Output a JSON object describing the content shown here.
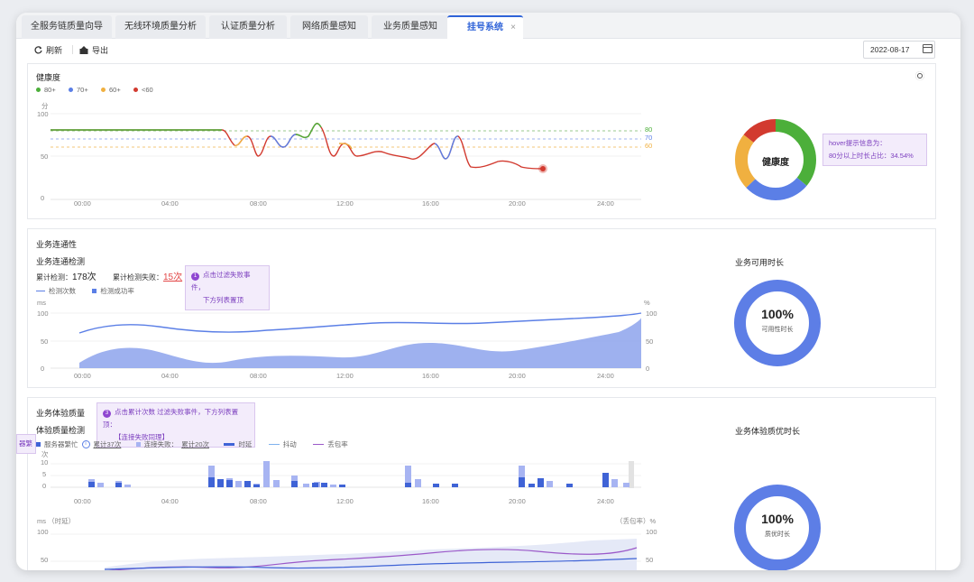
{
  "tabs": [
    {
      "label": "全服务链质量向导"
    },
    {
      "label": "无线环境质量分析"
    },
    {
      "label": "认证质量分析"
    },
    {
      "label": "网络质量感知"
    },
    {
      "label": "业务质量感知"
    },
    {
      "label": "挂号系统",
      "active": true,
      "close": "×"
    }
  ],
  "toolbar": {
    "refresh": "刷新",
    "export": "导出",
    "date": "2022-08-17"
  },
  "health": {
    "title": "健康度",
    "legend": [
      {
        "label": "80+",
        "color": "#4caf3a"
      },
      {
        "label": "70+",
        "color": "#5b7fe6"
      },
      {
        "label": "60+",
        "color": "#f0b040"
      },
      {
        "label": "<60",
        "color": "#d23a2f"
      }
    ],
    "unit": "分",
    "y_ticks": [
      "100",
      "50",
      "0"
    ],
    "x_ticks": [
      "00:00",
      "04:00",
      "08:00",
      "12:00",
      "16:00",
      "20:00",
      "24:00"
    ],
    "thresholds": [
      "80",
      "70",
      "60"
    ],
    "donut_label": "健康度",
    "tooltip_line1": "hover提示信息为：",
    "tooltip_line2": "80分以上时长占比：34.54%"
  },
  "connectivity": {
    "section_title": "业务连通性",
    "sub_title": "业务连通检测",
    "total_label": "累计检测：",
    "total_value": "178次",
    "fail_label": "累计检测失败：",
    "fail_value": "15次",
    "tip_num": "1",
    "tip_line1": "点击过滤失败事件，",
    "tip_line2": "下方列表置顶",
    "legend_line": "检测次数",
    "legend_bar": "检测成功率",
    "left_unit": "ms",
    "right_unit": "%",
    "y_ticks": [
      "100",
      "50",
      "0"
    ],
    "x_ticks": [
      "00:00",
      "04:00",
      "08:00",
      "12:00",
      "16:00",
      "20:00",
      "24:00"
    ],
    "side_title": "业务可用时长",
    "ring_value": "100%",
    "ring_label": "可用性时长"
  },
  "experience": {
    "section_title": "业务体验质量",
    "sub_title": "体验质量检测",
    "tip_num": "3",
    "tip_line1": "点击累计次数 过滤失败事件，下方列表置顶：",
    "tip_line2": "【连接失败同理】",
    "left_tip": "器繁",
    "legend": [
      {
        "label": "服务器繁忙",
        "extra": "累计37次",
        "color": "#3f63d6"
      },
      {
        "label": "连接失败：",
        "extra": "累计20次",
        "color": "#a7b4f2"
      },
      {
        "label": "时延",
        "color": "#3f63d6"
      },
      {
        "label": "抖动",
        "color": "#7fb2ee"
      },
      {
        "label": "丢包率",
        "color": "#9b59c9"
      }
    ],
    "count_unit": "次",
    "count_ticks": [
      "10",
      "5",
      "0"
    ],
    "x_ticks": [
      "00:00",
      "04:00",
      "08:00",
      "12:00",
      "16:00",
      "20:00",
      "24:00"
    ],
    "lower_left_unit": "ms （时延）",
    "lower_right_unit": "（丢包率）%",
    "lower_ticks": [
      "100",
      "50"
    ],
    "side_title": "业务体验质优时长",
    "ring_value": "100%",
    "ring_label": "质优时长"
  }
}
